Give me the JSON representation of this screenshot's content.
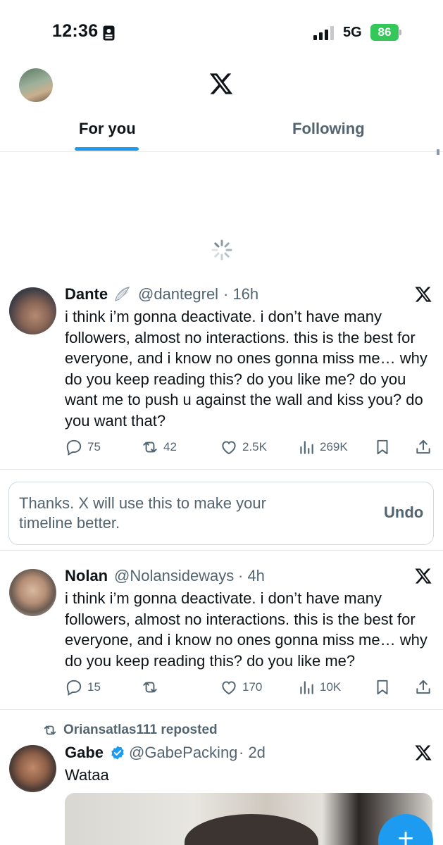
{
  "status_bar": {
    "time": "12:36",
    "network": "5G",
    "battery": "86"
  },
  "header": {
    "logo": "x-logo",
    "tabs": [
      {
        "label": "For you",
        "active": true
      },
      {
        "label": "Following",
        "active": false
      }
    ]
  },
  "colors": {
    "accent": "#1d9bf0",
    "text": "#0f1419",
    "secondary": "#536471",
    "battery": "#34c759"
  },
  "posts": [
    {
      "name": "Dante",
      "badge": "wing-emoji",
      "handle": "@dantegrel",
      "time": "· 16h",
      "text": "i think i’m gonna deactivate. i don’t have many followers, almost no interactions. this is the best for everyone, and i know no ones gonna miss me… why do you keep reading this? do you like me? do you want me to push u against the wall and kiss you? do you want that?",
      "replies": "75",
      "reposts": "42",
      "likes": "2.5K",
      "views": "269K"
    },
    {
      "name": "Nolan",
      "handle": "@Nolansideways",
      "time": "· 4h",
      "text": "i think i’m gonna deactivate. i don’t have many followers, almost no interactions. this is the best for everyone, and i know no ones gonna miss me… why do you keep reading this? do you like me?",
      "replies": "15",
      "reposts": "",
      "likes": "170",
      "views": "10K"
    },
    {
      "repost_label": "Oriansatlas111 reposted",
      "name": "Gabe",
      "verified": true,
      "handle": "@GabePacking",
      "time": "· 2d",
      "text": "Wataa"
    }
  ],
  "feedback_notice": {
    "message": "Thanks. X will use this to make your timeline better.",
    "undo_label": "Undo"
  },
  "fab": {
    "label": "+"
  }
}
